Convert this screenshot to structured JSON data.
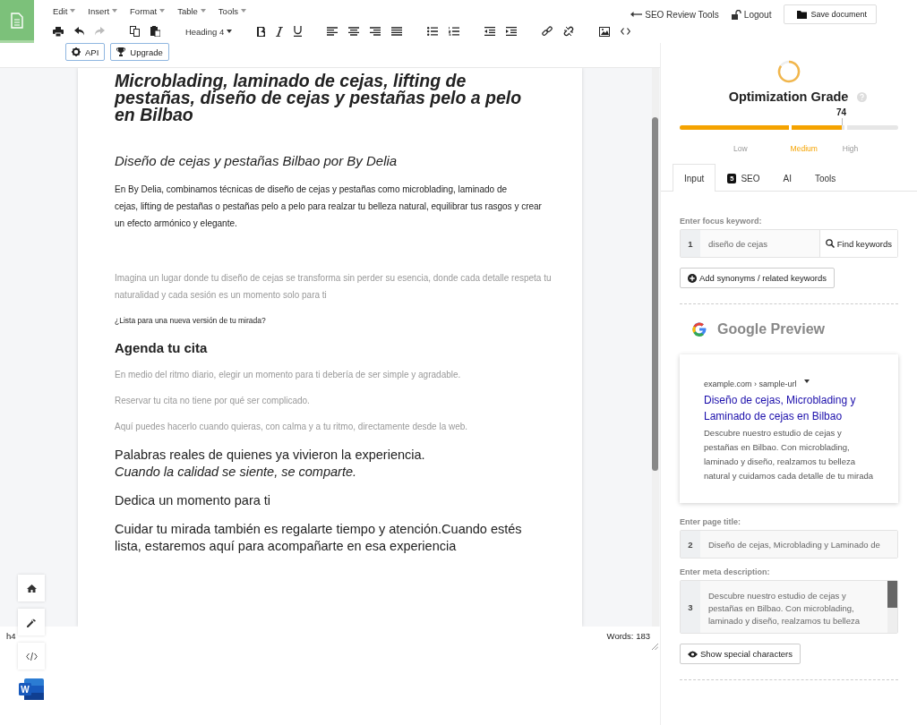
{
  "header": {
    "menu": [
      {
        "label": "Edit"
      },
      {
        "label": "Insert"
      },
      {
        "label": "Format"
      },
      {
        "label": "Table"
      },
      {
        "label": "Tools"
      }
    ],
    "toolbar": {
      "undo": {
        "disabled": false
      },
      "redo": {
        "disabled": true
      },
      "heading_select": "Heading 4"
    },
    "links": [
      {
        "kind": "back",
        "label": "SEO Review Tools"
      },
      {
        "kind": "logout",
        "label": "Logout"
      }
    ],
    "save_button": "Save document"
  },
  "word_icon_letter": "W",
  "editor_buttons": [
    {
      "kind": "api",
      "label": "API"
    },
    {
      "kind": "upgrade",
      "label": "Upgrade"
    }
  ],
  "document": {
    "blocks": [
      {
        "kind": "h1",
        "text": "Microblading, laminado de cejas, lifting de pestañas, diseño de cejas y pestañas pelo a pelo en Bilbao"
      },
      {
        "kind": "h3",
        "text": "Diseño de cejas y pestañas Bilbao por By Delia"
      },
      {
        "kind": "p",
        "text": "En By Delia, combinamos técnicas de diseño de cejas y pestañas como microblading, laminado de\ncejas, lifting de pestañas o pestañas pelo a pelo para realzar tu belleza natural, equilibrar tus rasgos y crear un efecto armónico y elegante."
      },
      {
        "kind": "muted",
        "text": "Imagina un lugar donde tu diseño de cejas se transforma sin perder su esencia, donde cada detalle respeta tu naturalidad y cada sesión es un momento solo para ti"
      },
      {
        "kind": "small",
        "text": "¿Lista para una nueva versión de tu mirada?"
      },
      {
        "kind": "h2",
        "text": "Agenda tu cita"
      },
      {
        "kind": "muted",
        "text": "En medio del ritmo diario, elegir un momento para ti debería de ser simple y agradable."
      },
      {
        "kind": "muted",
        "text": "Reservar tu cita no tiene por qué ser complicado."
      },
      {
        "kind": "muted",
        "text": "Aquí puedes hacerlo cuando quieras, con calma y a tu ritmo, directamente desde la web."
      },
      {
        "kind": "large",
        "text": "Palabras reales de quienes ya vivieron la experiencia.\n*Cuando la calidad se siente, se comparte.*"
      },
      {
        "kind": "large",
        "text": "Dedica un momento para ti"
      },
      {
        "kind": "large",
        "text": "Cuidar tu mirada también es regalarte tiempo y atención.Cuando estés lista, estaremos aquí para acompañarte en esa experiencia"
      }
    ]
  },
  "status_bar": {
    "element_path": "h4",
    "word_count": "Words: 183"
  },
  "grade": {
    "title": "Optimization Grade",
    "score": "74",
    "level": 0.74,
    "bands": [
      {
        "label": "Low",
        "selected": false
      },
      {
        "label": "Medium",
        "selected": true
      },
      {
        "label": "High",
        "selected": false
      }
    ]
  },
  "tabs": [
    {
      "label": "Input",
      "selected": true
    },
    {
      "label": "SEO",
      "badge": "5",
      "selected": false
    },
    {
      "label": "AI",
      "selected": false
    },
    {
      "label": "Tools",
      "selected": false
    }
  ],
  "focus_keyword": {
    "label": "Enter focus keyword:",
    "number": "1",
    "value": "diseño de cejas",
    "button": "Find keywords"
  },
  "synonyms_button": "Add synonyms / related keywords",
  "google_preview": {
    "heading": "Google Preview",
    "url": "example.com › sample-url",
    "title": "Diseño de cejas, Microblading y Laminado de cejas en Bilbao",
    "description": "Descubre nuestro estudio de cejas y pestañas en Bilbao. Con microblading, laminado y diseño, realzamos tu belleza natural y cuidamos cada detalle de tu mirada"
  },
  "page_title": {
    "label": "Enter page title:",
    "number": "2",
    "value": "Diseño de cejas, Microblading y Laminado de"
  },
  "meta_description": {
    "label": "Enter meta description:",
    "number": "3",
    "value": "Descubre nuestro estudio de cejas  y pestañas en Bilbao. Con microblading, laminado y diseño, realzamos tu belleza"
  },
  "special_chars_button": "Show special characters"
}
